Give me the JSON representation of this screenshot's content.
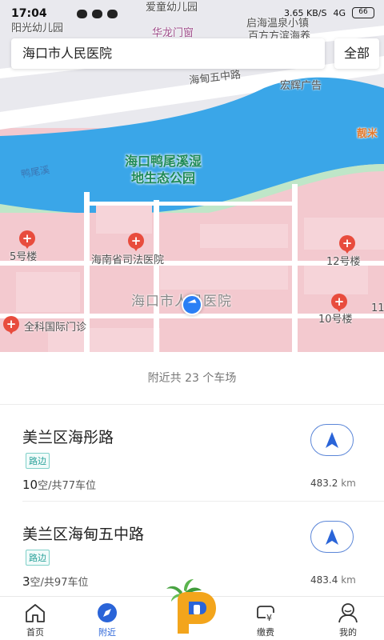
{
  "status_bar": {
    "time": "17:04",
    "network_speed": "3.65 KB/S",
    "signal": "4G",
    "battery": "66"
  },
  "map": {
    "labels": {
      "kindergarten": "阳光幼儿园",
      "kindergarten2": "爱童幼儿园",
      "hualong": "华龙门窗",
      "baifang": "百方方滨海养",
      "wenquan": "启海温泉小镇",
      "road": "海甸五中路",
      "hongwei": "宏辉广告",
      "lanmi": "靓米",
      "park": "海口鸭尾溪湿\n地生态公园",
      "river": "鸭尾溪",
      "building5": "5号楼",
      "justice": "海南省司法医院",
      "building12": "12号楼",
      "hospital": "海口市人民医院",
      "building10": "10号楼",
      "quanke": "全科国际门诊",
      "building11": "11"
    },
    "colors": {
      "water": "#3aa6e8",
      "land": "#f3c9cf",
      "park": "#1f8a58",
      "road": "#ffffff",
      "pin": "#e84c3d",
      "accent": "#2a64d8"
    }
  },
  "search": {
    "value": "海口市人民医院",
    "filter_label": "全部"
  },
  "sheet": {
    "title": "附近共 23 个车场",
    "lots": [
      {
        "name": "美兰区海彤路",
        "tag": "路边",
        "free": "10",
        "spaces_text": "空/共77车位",
        "distance": "483.2",
        "unit": "km"
      },
      {
        "name": "美兰区海甸五中路",
        "tag": "路边",
        "free": "3",
        "spaces_text": "空/共97车位",
        "distance": "483.4",
        "unit": "km"
      }
    ]
  },
  "tabbar": {
    "home": "首页",
    "nearby": "附近",
    "pay": "缴费",
    "mine": "我的",
    "icons": [
      "home-icon",
      "compass-icon",
      "app-logo",
      "car-payment-icon",
      "user-icon"
    ]
  }
}
